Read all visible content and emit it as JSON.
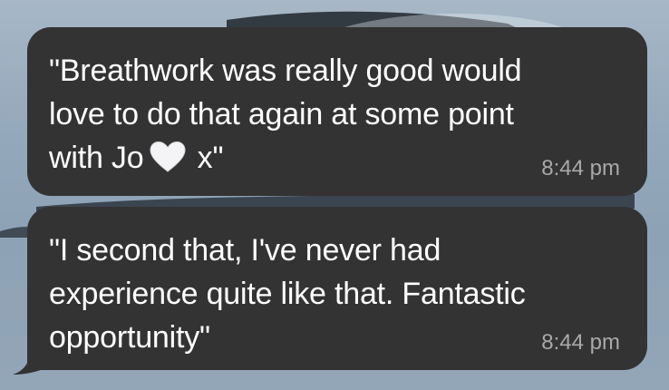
{
  "conversation": {
    "messages": [
      {
        "text_before_icon": "\"Breathwork was really good would\nlove to do that again at some point\nwith Jo",
        "icon": "white-heart-icon",
        "text_after_icon": " x\"",
        "time": "8:44 pm"
      },
      {
        "text": "\"I second that, I've never had\nexperience quite like that. Fantastic\nopportunity\"",
        "time": "8:44 pm"
      }
    ]
  },
  "colors": {
    "bubble": "#333334",
    "text": "#ffffff",
    "timestamp": "#a9a9aa",
    "background": "#8fa3b5"
  }
}
